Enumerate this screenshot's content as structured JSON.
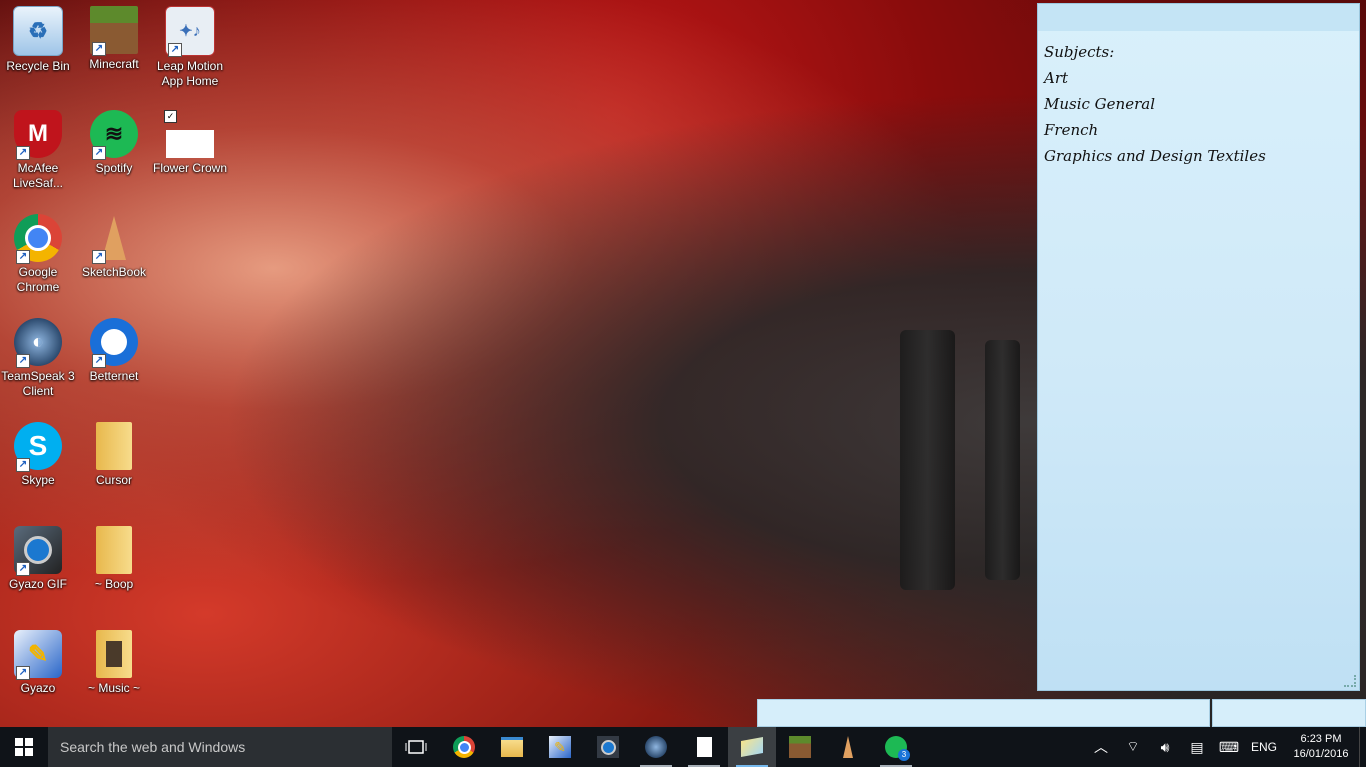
{
  "desktop": {
    "icons": [
      {
        "label": "Recycle Bin",
        "icon": "recycle-bin-icon",
        "color": "#9fc5e8"
      },
      {
        "label": "Minecraft",
        "icon": "minecraft-icon",
        "color": "#5d8a2c"
      },
      {
        "label": "Leap Motion App Home",
        "icon": "leap-motion-icon",
        "color": "#e8eef4"
      },
      {
        "label": "McAfee LiveSaf...",
        "icon": "mcafee-icon",
        "color": "#c0141c"
      },
      {
        "label": "Spotify",
        "icon": "spotify-icon",
        "color": "#1db954"
      },
      {
        "label": "Flower Crown",
        "icon": "flower-crown-file-icon",
        "color": "#ffffff"
      },
      {
        "label": "Google Chrome",
        "icon": "chrome-icon",
        "color": "#4285f4"
      },
      {
        "label": "SketchBook",
        "icon": "sketchbook-icon",
        "color": "#e0a060"
      },
      {
        "label": "TeamSpeak 3 Client",
        "icon": "teamspeak-icon",
        "color": "#2c4a6e"
      },
      {
        "label": "Betternet",
        "icon": "betternet-icon",
        "color": "#1a6fd8"
      },
      {
        "label": "Skype",
        "icon": "skype-icon",
        "color": "#00aff0"
      },
      {
        "label": "Cursor",
        "icon": "folder-icon",
        "color": "#f2c96a"
      },
      {
        "label": "Gyazo GIF",
        "icon": "gyazo-gif-icon",
        "color": "#333a44"
      },
      {
        "label": "~ Boop",
        "icon": "folder-icon",
        "color": "#f2c96a"
      },
      {
        "label": "Gyazo",
        "icon": "gyazo-icon",
        "color": "#2a66c9"
      },
      {
        "label": "~ Music ~",
        "icon": "folder-music-icon",
        "color": "#f2c96a"
      }
    ]
  },
  "sticky_note": {
    "lines": [
      "Subjects:",
      "Art",
      "Music General",
      "French",
      "Graphics and Design Textiles"
    ]
  },
  "taskbar": {
    "search_placeholder": "Search the web and Windows",
    "apps": [
      "task-view-icon",
      "chrome-icon",
      "file-explorer-icon",
      "gyazo-icon",
      "gyazo-gif-icon",
      "teamspeak-icon",
      "notepad-icon",
      "sticky-notes-icon",
      "minecraft-icon",
      "sketchbook-icon",
      "spotify-icon"
    ],
    "spotify_badge": "3",
    "language": "ENG",
    "time": "6:23 PM",
    "date": "16/01/2016"
  },
  "colors": {
    "taskbar": "#0f1318",
    "search_box": "#2b2f33",
    "accent": "#76b9ed",
    "sticky": "#cfe9f8"
  }
}
